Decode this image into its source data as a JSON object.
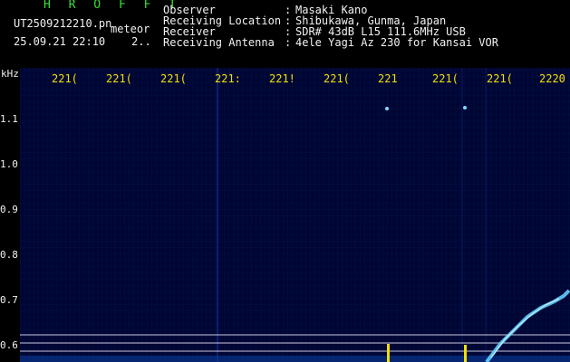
{
  "header": {
    "brand": "H R O F F T",
    "filename": "UT2509212210.pn",
    "meteor_label": "meteor",
    "datetime": "25.09.21 22:10    2..",
    "info": [
      {
        "key": "Observer",
        "value": "Masaki Kano"
      },
      {
        "key": "Receiving Location",
        "value": "Shibukawa, Gunma, Japan"
      },
      {
        "key": "Receiver",
        "value": "SDR# 43dB L15 111.6MHz USB"
      },
      {
        "key": "Receiving Antenna",
        "value": "4ele Yagi Az 230 for Kansai VOR"
      }
    ]
  },
  "axis": {
    "unit": "kHz",
    "time_ticks": [
      "221(",
      "221(",
      "221(",
      "221:",
      "221!",
      "221(",
      "221",
      "221(",
      "221(",
      "2220"
    ],
    "freq_ticks": [
      "1.1",
      "1.0",
      "0.9",
      "0.8",
      "0.7",
      "0.6"
    ]
  },
  "colors": {
    "background": "#000000",
    "plot_bg": "#000633",
    "brand": "#35e035",
    "tick_text": "#f2e000",
    "echo": "#5fd0ff"
  }
}
